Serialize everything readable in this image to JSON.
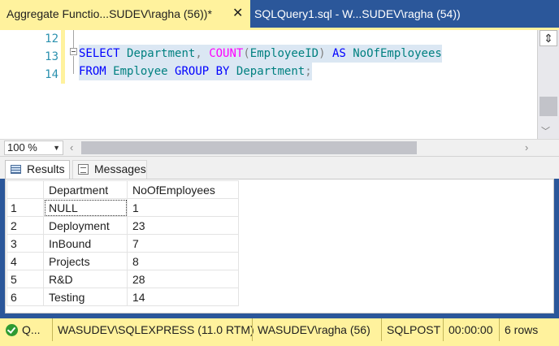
{
  "tabs": [
    {
      "label": "Aggregate Functio...SUDEV\\ragha (56))*",
      "close": "✕",
      "active": true
    },
    {
      "label": "SQLQuery1.sql - W...SUDEV\\ragha (54))",
      "active": false
    }
  ],
  "editor": {
    "line_numbers": [
      "12",
      "13",
      "14"
    ],
    "line13": {
      "select": "SELECT",
      "department": "Department",
      "comma": ",",
      "count": "COUNT",
      "paren_open": "(",
      "employee_id": "EmployeeID",
      "paren_close": ")",
      "as": "AS",
      "alias": "NoOfEmployees"
    },
    "line14": {
      "from": "FROM",
      "employee": "Employee",
      "group_by": "GROUP BY",
      "department": "Department",
      "semicolon": ";"
    }
  },
  "zoom": {
    "value": "100 %"
  },
  "result_tabs": {
    "results": "Results",
    "messages": "Messages"
  },
  "grid": {
    "headers": [
      "Department",
      "NoOfEmployees"
    ],
    "rows": [
      {
        "n": "1",
        "dept": "NULL",
        "count": "1"
      },
      {
        "n": "2",
        "dept": "Deployment",
        "count": "23"
      },
      {
        "n": "3",
        "dept": "InBound",
        "count": "7"
      },
      {
        "n": "4",
        "dept": "Projects",
        "count": "8"
      },
      {
        "n": "5",
        "dept": "R&D",
        "count": "28"
      },
      {
        "n": "6",
        "dept": "Testing",
        "count": "14"
      }
    ]
  },
  "status": {
    "state": "Q...",
    "server": "WASUDEV\\SQLEXPRESS (11.0 RTM)",
    "user": "WASUDEV\\ragha (56)",
    "database": "SQLPOST",
    "elapsed": "00:00:00",
    "rows": "6 rows"
  },
  "colors": {
    "accent_yellow": "#fff29d",
    "tab_blue": "#2b579a",
    "keyword": "#0000ff",
    "identifier": "#008080",
    "function": "#ff00ff"
  },
  "icons": {
    "status": "success-check-icon",
    "results_tab": "grid-icon",
    "messages_tab": "messages-icon"
  }
}
